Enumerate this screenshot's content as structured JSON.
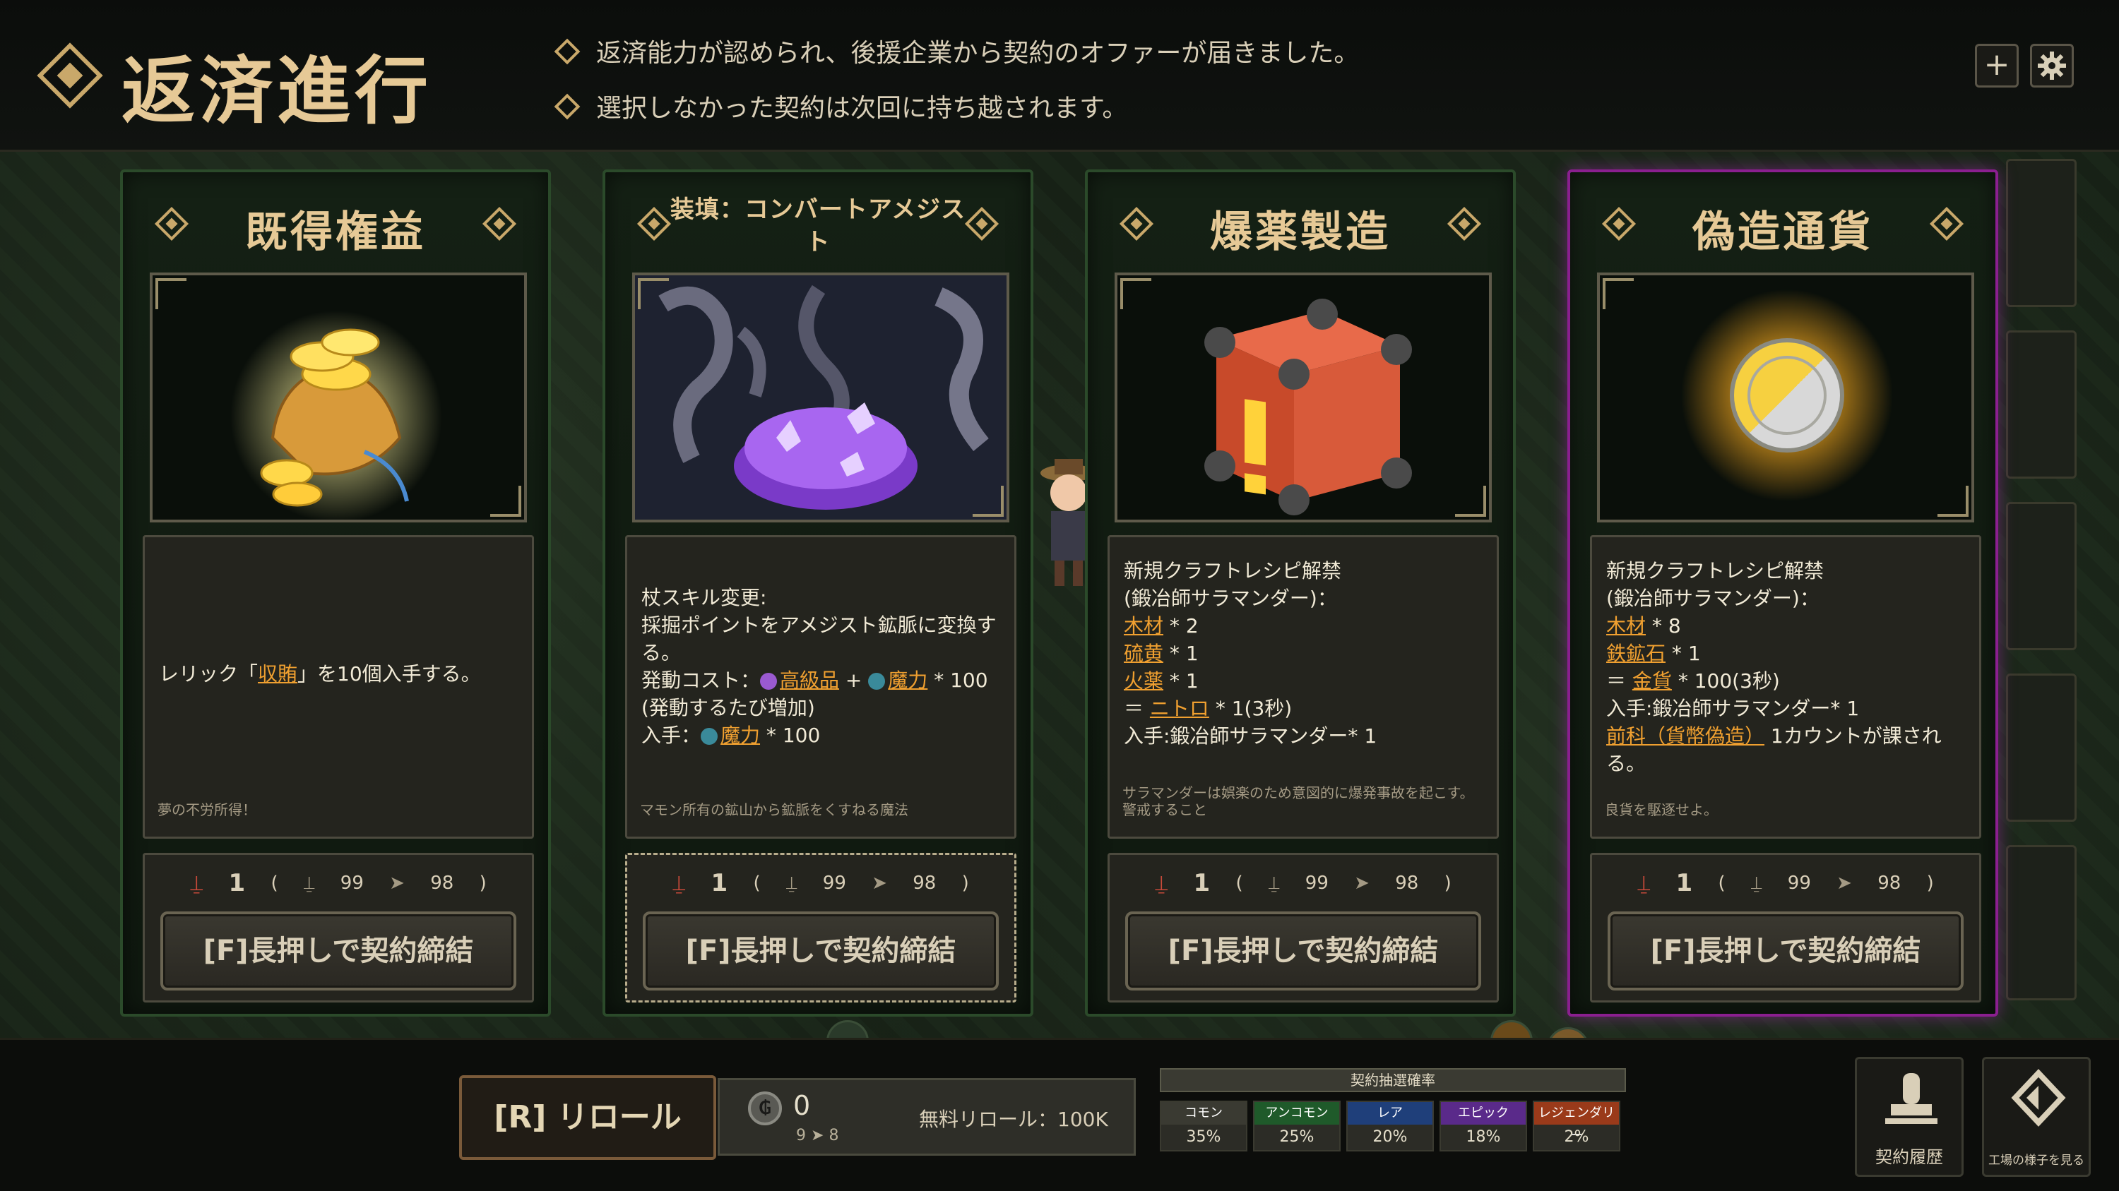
{
  "header": {
    "title": "返済進行",
    "notices": [
      "返済能力が認められ、後援企業から契約のオファーが届きました。",
      "選択しなかった契約は次回に持ち越されます。"
    ],
    "add_button": "+",
    "settings_icon": "gear-icon"
  },
  "cards": [
    {
      "title": "既得権益",
      "art": "gold-coins-pouch",
      "description_pre": "レリック「",
      "description_link": "収賄",
      "description_post": "」を10個入手する。",
      "flavor": "夢の不労所得！",
      "count": "1",
      "stock_a": "99",
      "stock_b": "98",
      "button": "[F]長押しで契約締結"
    },
    {
      "title": "装填：コンバートアメジスト",
      "art": "amethyst-gem",
      "lines": {
        "l1": "杖スキル変更:",
        "l2": "採掘ポイントをアメジスト鉱脈に変換する。",
        "l3_pre": "発動コスト：",
        "l3_link1": "高級品",
        "l3_mid": " + ",
        "l3_link2": "魔力",
        "l3_post": " * 100",
        "l4": "(発動するたび増加)",
        "l5_pre": "入手：",
        "l5_link": "魔力",
        "l5_post": " * 100"
      },
      "flavor": "マモン所有の鉱山から鉱脈をくすねる魔法",
      "count": "1",
      "stock_a": "99",
      "stock_b": "98",
      "button": "[F]長押しで契約締結"
    },
    {
      "title": "爆薬製造",
      "art": "explosive-crate",
      "lines": {
        "l1": "新規クラフトレシピ解禁",
        "l2": "(鍛冶師サラマンダー)：",
        "m1": "木材",
        "m1q": " * 2",
        "m2": "硫黄",
        "m2q": " * 1",
        "m3": "火薬",
        "m3q": " * 1",
        "r_pre": " ＝ ",
        "r": "ニトロ",
        "rq": " * 1(3秒)",
        "acq": "入手:鍛冶師サラマンダー* 1"
      },
      "flavor": "サラマンダーは娯楽のため意図的に爆発事故を起こす。警戒すること",
      "count": "1",
      "stock_a": "99",
      "stock_b": "98",
      "button": "[F]長押しで契約締結"
    },
    {
      "title": "偽造通貨",
      "art": "counterfeit-coin",
      "lines": {
        "l1": "新規クラフトレシピ解禁",
        "l2": "(鍛冶師サラマンダー)：",
        "m1": "木材",
        "m1q": " * 8",
        "m2": "鉄鉱石",
        "m2q": " * 1",
        "r_pre": " ＝ ",
        "r": "金貨",
        "rq": " * 100(3秒)",
        "acq": "入手:鍛冶師サラマンダー* 1",
        "pen_link": "前科（貨幣偽造）",
        "pen_post": " 1カウントが課される。"
      },
      "flavor": "良貨を駆逐せよ。",
      "count": "1",
      "stock_a": "99",
      "stock_b": "98",
      "button": "[F]長押しで契約締結"
    }
  ],
  "bottom": {
    "reroll_button": "[R] リロール",
    "reroll_count": "0",
    "reroll_sub_a": "9",
    "reroll_sub_b": "8",
    "free_reroll": "無料リロール：100K",
    "odds_title": "契約抽選確率",
    "odds": [
      {
        "name": "コモン",
        "pct": "35%",
        "color": "#3a3a32"
      },
      {
        "name": "アンコモン",
        "pct": "25%",
        "color": "#1f5a2a"
      },
      {
        "name": "レア",
        "pct": "20%",
        "color": "#1f3f7a"
      },
      {
        "name": "エピック",
        "pct": "18%",
        "color": "#5a2a8a"
      },
      {
        "name": "レジェンダリー",
        "pct": "2%",
        "color": "#9a3a1a"
      }
    ],
    "history_label": "契約履歴",
    "factory_label": "工場の様子を見る"
  }
}
